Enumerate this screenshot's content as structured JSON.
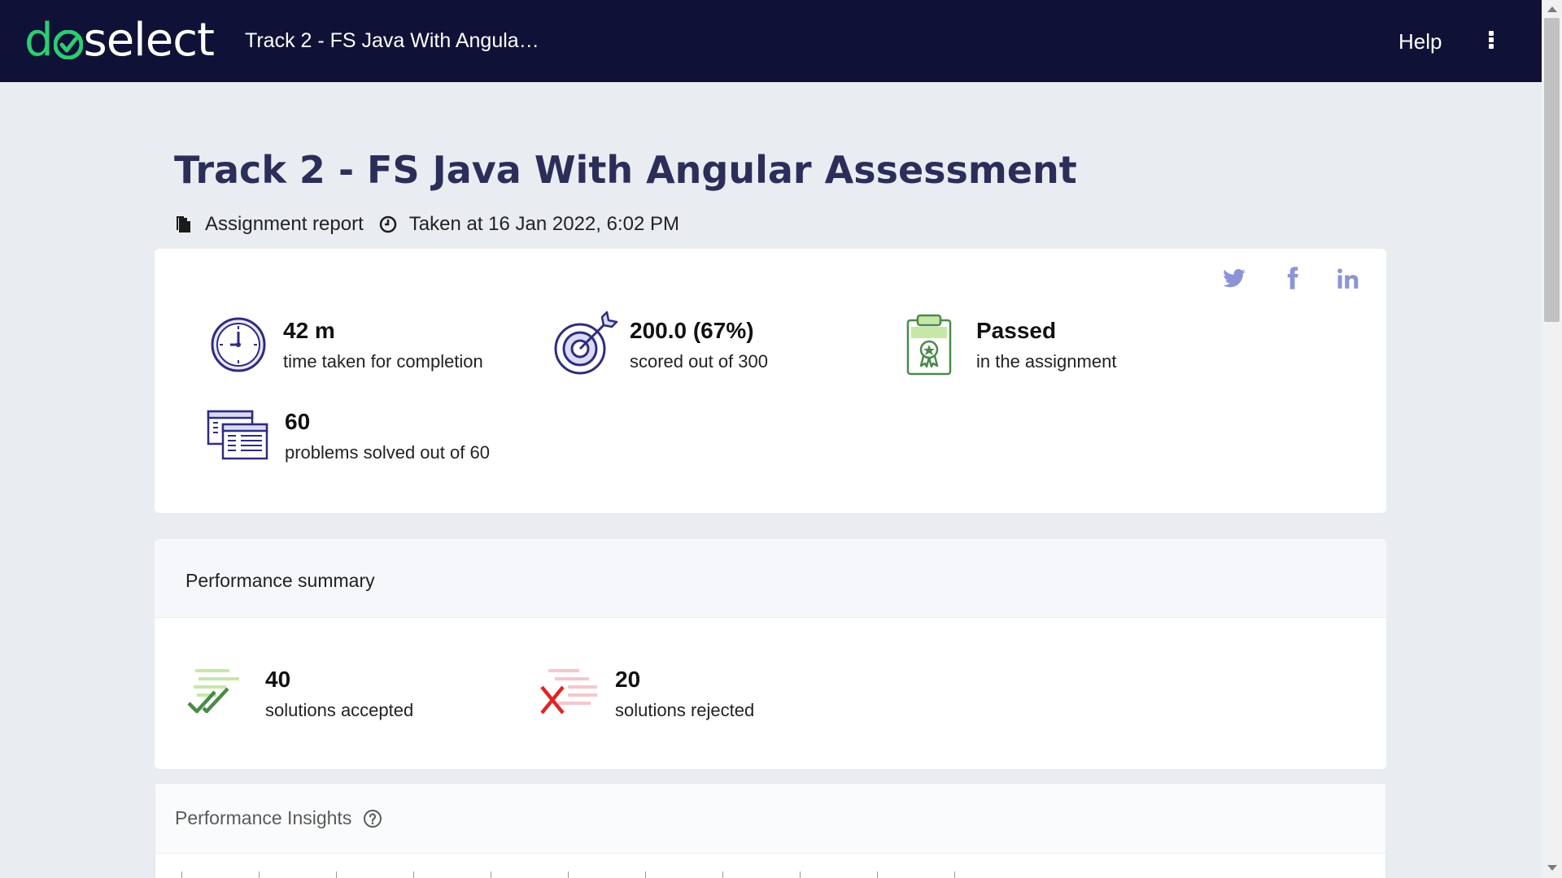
{
  "topbar": {
    "logo_text_d": "d",
    "logo_text_rest": "select",
    "title": "Track 2 - FS Java With Angula…",
    "help_label": "Help"
  },
  "page": {
    "title": "Track 2 - FS Java With Angular Assessment",
    "report_label": "Assignment report",
    "taken_at": "Taken at 16 Jan 2022, 6:02 PM"
  },
  "social": [
    "twitter-icon",
    "facebook-icon",
    "linkedin-icon"
  ],
  "stats": {
    "time": {
      "value": "42 m",
      "label": "time taken for completion"
    },
    "score": {
      "value": "200.0 (67%)",
      "label": "scored out of 300"
    },
    "result": {
      "value": "Passed",
      "label": "in the assignment"
    },
    "problems": {
      "value": "60",
      "label": "problems solved out of 60"
    }
  },
  "summary": {
    "title": "Performance summary",
    "accepted": {
      "value": "40",
      "label": "solutions accepted"
    },
    "rejected": {
      "value": "20",
      "label": "solutions rejected"
    }
  },
  "insights": {
    "title": "Performance Insights"
  },
  "colors": {
    "topbar": "#0f1236",
    "brand_green": "#2ecc71",
    "title": "#2c2e5a",
    "icon_navy": "#2f2c7e",
    "social": "#8d94d6"
  }
}
